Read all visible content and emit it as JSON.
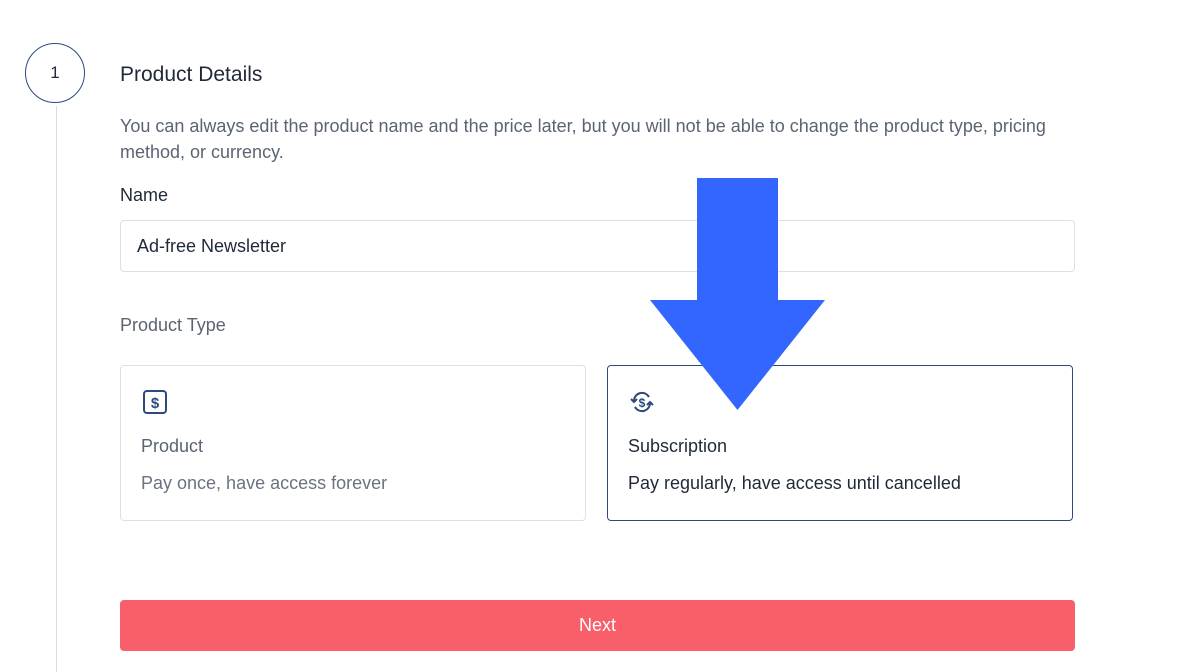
{
  "step": {
    "number": "1",
    "title": "Product Details",
    "description": "You can always edit the product name and the price later, but you will not be able to change the product type, pricing method, or currency."
  },
  "name_field": {
    "label": "Name",
    "value": "Ad-free Newsletter"
  },
  "product_type": {
    "label": "Product Type",
    "options": [
      {
        "icon": "dollar-square-icon",
        "title": "Product",
        "subtitle": "Pay once, have access forever",
        "selected": false
      },
      {
        "icon": "recurring-dollar-icon",
        "title": "Subscription",
        "subtitle": "Pay regularly, have access until cancelled",
        "selected": true
      }
    ]
  },
  "next_button": {
    "label": "Next"
  },
  "colors": {
    "accent": "#2c4a7e",
    "button": "#f85f6a",
    "arrow": "#3366ff"
  }
}
